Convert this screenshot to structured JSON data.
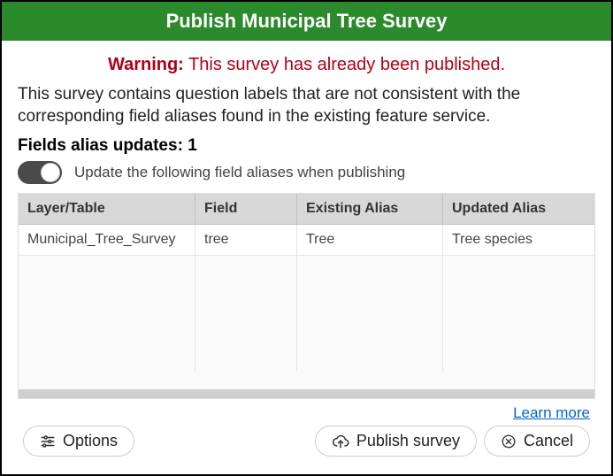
{
  "title": "Publish Municipal Tree Survey",
  "warning": {
    "prefix": "Warning:",
    "message": "This survey has already been published."
  },
  "info": "This survey contains question labels that are not consistent with the corresponding field aliases found in the existing feature service.",
  "alias": {
    "heading_prefix": "Fields alias updates:",
    "count": "1",
    "toggle_label": "Update the following field aliases when publishing"
  },
  "table": {
    "headers": {
      "layer": "Layer/Table",
      "field": "Field",
      "existing": "Existing Alias",
      "updated": "Updated Alias"
    },
    "rows": [
      {
        "layer": "Municipal_Tree_Survey",
        "field": "tree",
        "existing": "Tree",
        "updated": "Tree species"
      }
    ]
  },
  "links": {
    "learn_more": "Learn more"
  },
  "buttons": {
    "options": "Options",
    "publish": "Publish survey",
    "cancel": "Cancel"
  }
}
